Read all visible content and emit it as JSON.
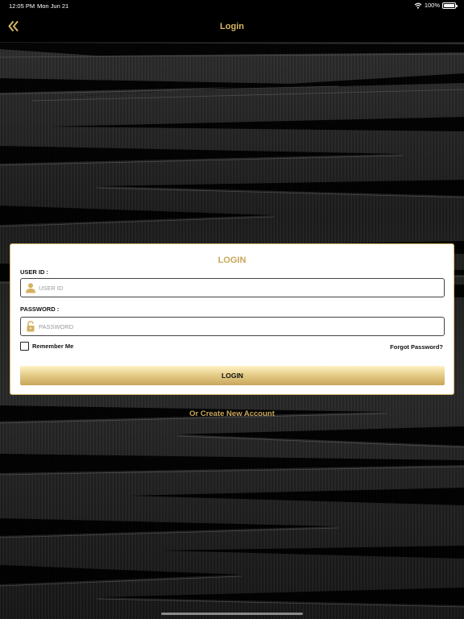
{
  "status_bar": {
    "time": "12:05 PM",
    "date": "Mon Jun 21",
    "battery": "100%"
  },
  "nav": {
    "title": "Login",
    "back_icon": "double-chevron-left-icon"
  },
  "card": {
    "title": "LOGIN",
    "user_id_label": "USER ID :",
    "user_id_placeholder": "USER ID",
    "user_id_value": "",
    "password_label": "PASSWORD :",
    "password_placeholder": "PASSWORD",
    "password_value": "",
    "remember_label": "Remember Me",
    "remember_checked": false,
    "forgot_label": "Forgot Password?",
    "login_button": "LOGIN"
  },
  "create_account": "Or Create New Account",
  "colors": {
    "accent": "#c9a65a",
    "nav_title": "#d7b865",
    "background": "#1a1a1a"
  }
}
